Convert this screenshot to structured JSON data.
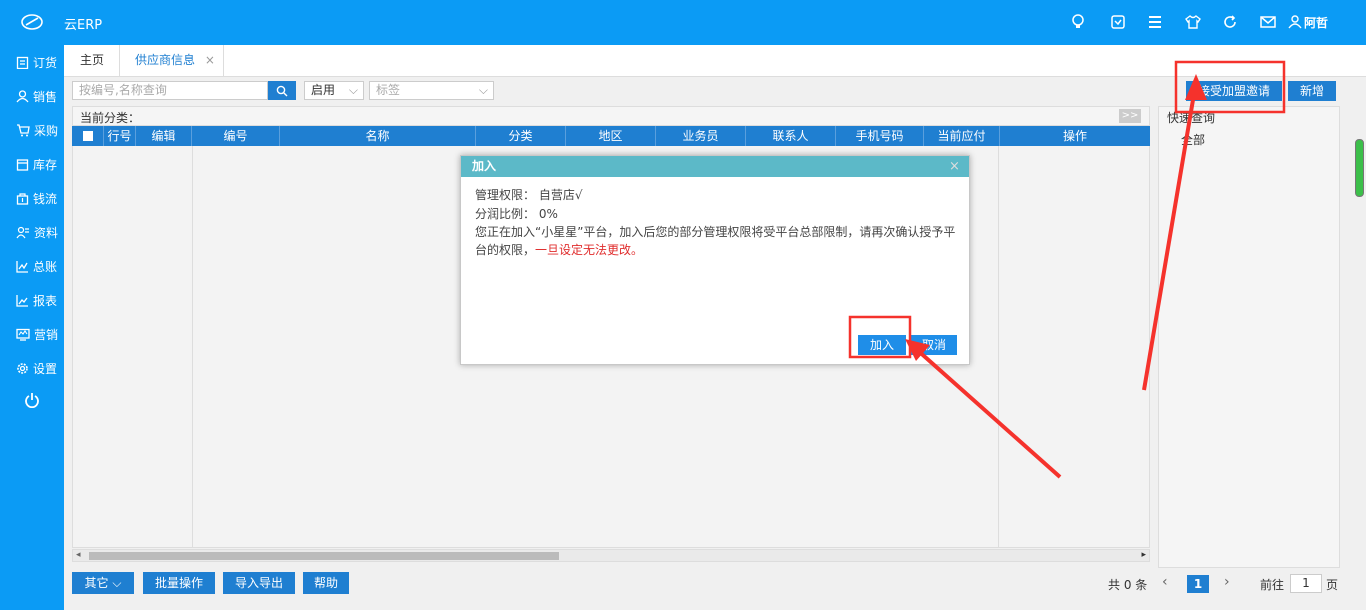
{
  "app": {
    "name": "云ERP",
    "user": "阿哲"
  },
  "colors": {
    "primary": "#0b9bf5",
    "grid_header": "#1f7fd1",
    "dialog_header": "#5cb9c8",
    "highlight": "#f5322c"
  },
  "topbar_icons": [
    "bulb-icon",
    "check-square-icon",
    "menu-icon",
    "shirt-icon",
    "refresh-icon",
    "mail-icon",
    "user-icon"
  ],
  "sidebar": {
    "items": [
      {
        "label": "订货",
        "icon": "clipboard-icon"
      },
      {
        "label": "销售",
        "icon": "person-icon"
      },
      {
        "label": "采购",
        "icon": "cart-icon"
      },
      {
        "label": "库存",
        "icon": "warehouse-icon"
      },
      {
        "label": "钱流",
        "icon": "money-icon"
      },
      {
        "label": "资料",
        "icon": "contacts-icon"
      },
      {
        "label": "总账",
        "icon": "ledger-chart-icon"
      },
      {
        "label": "报表",
        "icon": "report-chart-icon"
      },
      {
        "label": "营销",
        "icon": "marketing-icon"
      },
      {
        "label": "设置",
        "icon": "gear-icon"
      }
    ],
    "power_icon": "power-icon"
  },
  "tabs": [
    {
      "label": "主页"
    },
    {
      "label": "供应商信息",
      "closable": true
    }
  ],
  "toolbar": {
    "search_placeholder": "按编号,名称查询",
    "status_value": "启用",
    "tag_placeholder": "标签",
    "accept_invite": "接受加盟邀请",
    "add_new": "新增"
  },
  "category_label": "当前分类：",
  "collapse_label": ">>",
  "grid": {
    "columns": [
      "行号",
      "编辑",
      "编号",
      "名称",
      "分类",
      "地区",
      "业务员",
      "联系人",
      "手机号码",
      "当前应付",
      "操作"
    ]
  },
  "quick_query": {
    "title": "快速查询",
    "all": "全部"
  },
  "footer": {
    "buttons": [
      "其它",
      "批量操作",
      "导入导出",
      "帮助"
    ],
    "total": "共 0 条",
    "page": "1",
    "goto_label": "前往",
    "goto_value": "1",
    "page_suffix": "页"
  },
  "dialog": {
    "title": "加入",
    "lines": [
      "管理权限： 自营店√",
      "分润比例： 0%",
      "您正在加入“小星星”平台，加入后您的部分管理权限将受平台总部限制，请再次确认授予平"
    ],
    "line4_prefix": "台的权限，",
    "line4_warning": "一旦设定无法更改。",
    "join_button": "加入",
    "cancel_button": "取消"
  }
}
